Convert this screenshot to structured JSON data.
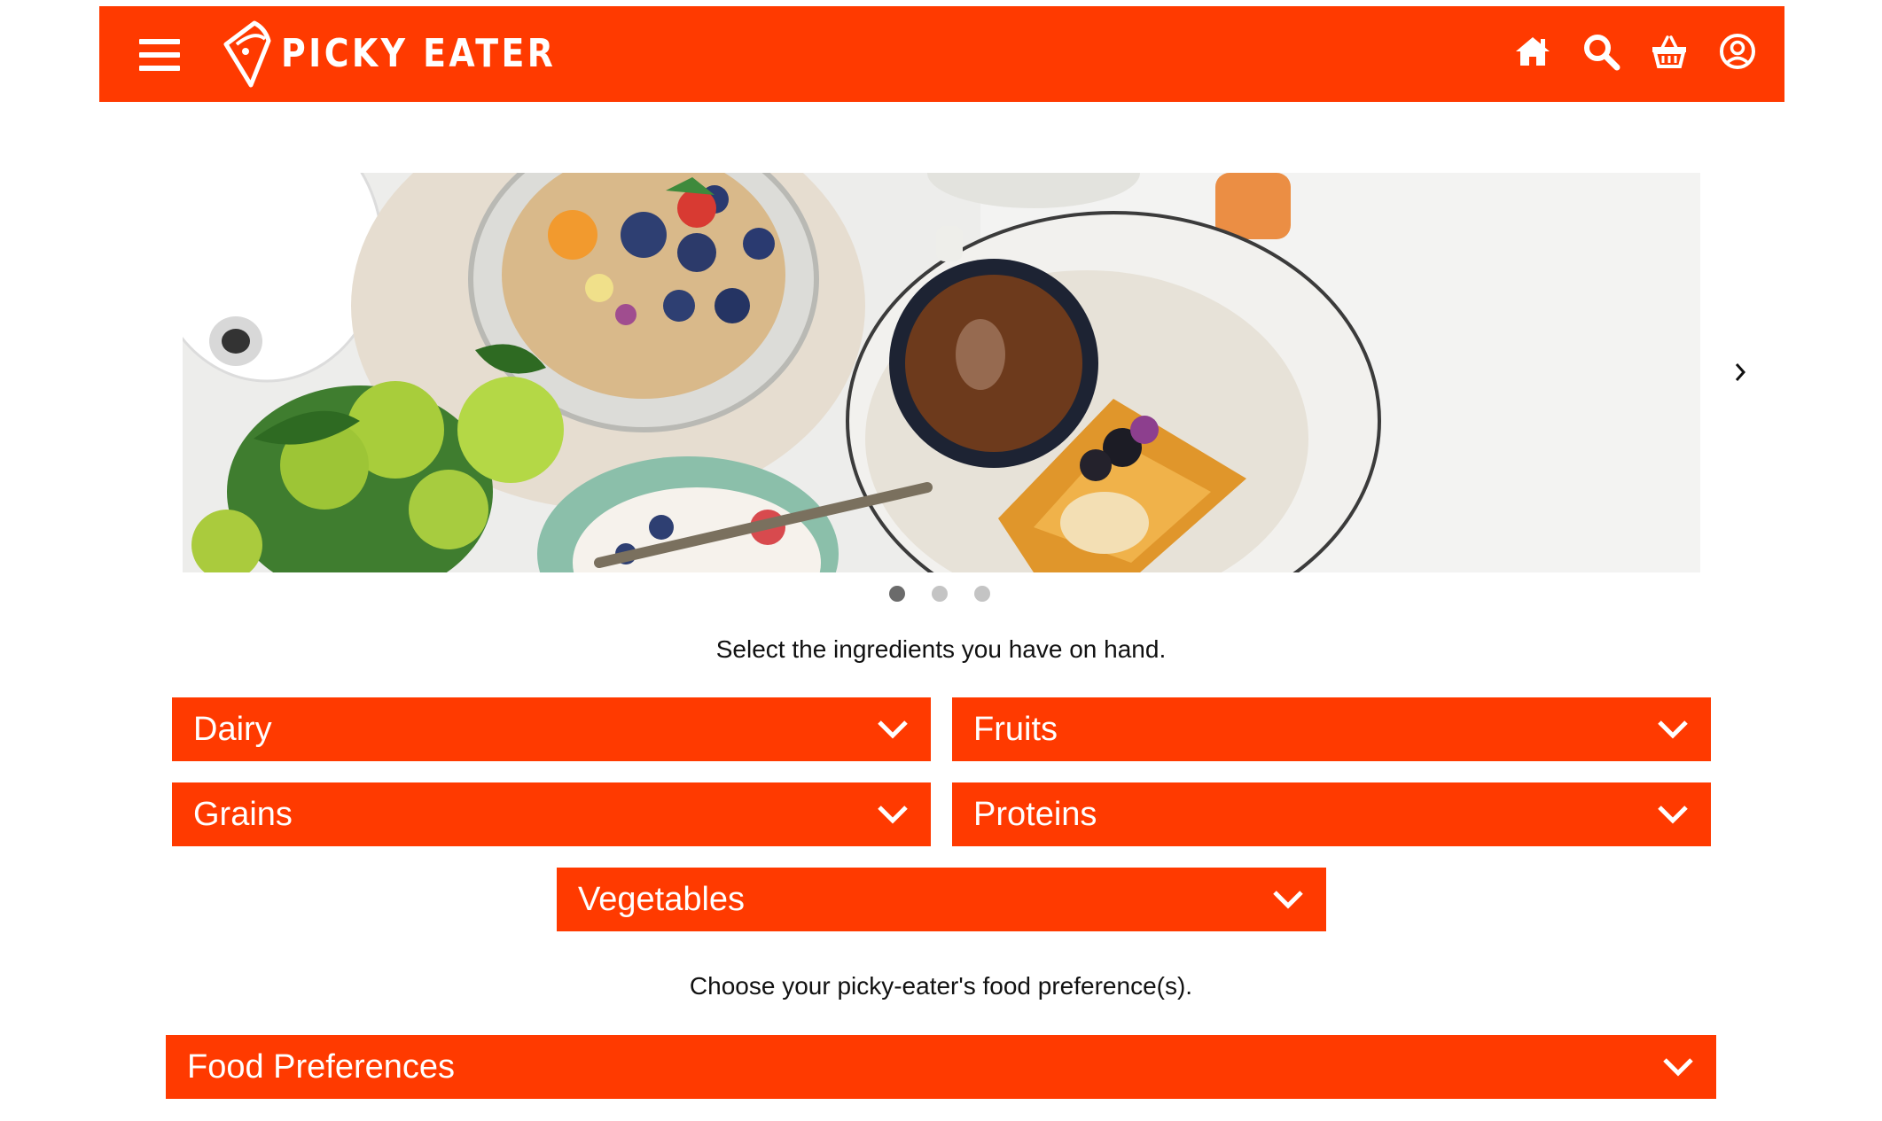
{
  "header": {
    "brand": "PICKY EATER",
    "icons": [
      "menu-icon",
      "home-icon",
      "search-icon",
      "basket-icon",
      "account-icon"
    ]
  },
  "carousel": {
    "slide_count": 3,
    "active_index": 0
  },
  "ingredients_prompt": "Select the ingredients you have on hand.",
  "ingredient_categories": [
    {
      "label": "Dairy"
    },
    {
      "label": "Fruits"
    },
    {
      "label": "Grains"
    },
    {
      "label": "Proteins"
    },
    {
      "label": "Vegetables"
    }
  ],
  "preferences_prompt": "Choose your picky-eater's food preference(s).",
  "preferences_dropdown": {
    "label": "Food Preferences"
  },
  "colors": {
    "brand": "#ff3a00",
    "dot_active": "#6b6b6b",
    "dot_inactive": "#c4c4c4"
  }
}
